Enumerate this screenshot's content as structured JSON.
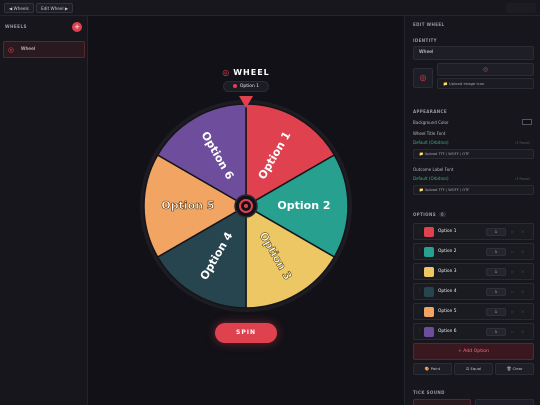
{
  "topbar": {
    "back_label": "◀ Wheels",
    "edit_label": "Edit Wheel ▶",
    "right_label": ""
  },
  "sidebar": {
    "title": "WHEELS",
    "add_label": "+",
    "items": [
      {
        "label": "Wheel"
      }
    ]
  },
  "wheel": {
    "title": "WHEEL",
    "selected": "Option 1",
    "spin_label": "SPIN",
    "hub_icon": "target-icon",
    "segments": [
      {
        "label": "Option 1",
        "color": "#e0414f"
      },
      {
        "label": "Option 2",
        "color": "#27a08f"
      },
      {
        "label": "Option 3",
        "color": "#ecc764"
      },
      {
        "label": "Option 4",
        "color": "#27454f"
      },
      {
        "label": "Option 5",
        "color": "#f2a563"
      },
      {
        "label": "Option 6",
        "color": "#6e4e9c"
      }
    ]
  },
  "editor": {
    "heading": "EDIT WHEEL",
    "identity": {
      "title": "IDENTITY",
      "name_value": "Wheel",
      "upload_icon_label": "📁 Upload image icon"
    },
    "appearance": {
      "title": "APPEARANCE",
      "bg_color_label": "Background Color",
      "title_font_label": "Wheel Title Font",
      "title_font_default": "Default (Orbitron)",
      "reset_label": "↺ Reset",
      "upload_font_label": "📁 Upload TTF / WOFF / OTF",
      "outcome_font_label": "Outcome Label Font",
      "outcome_font_default": "Default (Orbitron)"
    },
    "options": {
      "title": "OPTIONS",
      "count": "6",
      "weight": "1",
      "items": [
        {
          "label": "Option 1",
          "color": "#e0414f"
        },
        {
          "label": "Option 2",
          "color": "#27a08f"
        },
        {
          "label": "Option 3",
          "color": "#ecc764"
        },
        {
          "label": "Option 4",
          "color": "#27454f"
        },
        {
          "label": "Option 5",
          "color": "#f2a563"
        },
        {
          "label": "Option 6",
          "color": "#6e4e9c"
        }
      ],
      "add_label": "+ Add Option",
      "tools": [
        "🎨 Paint",
        "⚖ Equal",
        "🗑 Clear"
      ]
    },
    "tick_sound": {
      "title": "TICK SOUND"
    }
  }
}
